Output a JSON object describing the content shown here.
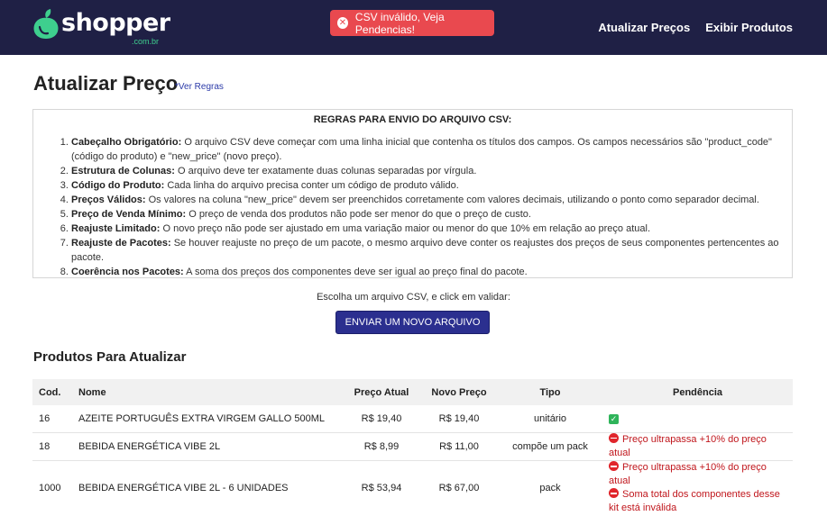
{
  "header": {
    "brand": "shopper",
    "brand_sub": ".com.br",
    "nav": [
      "Atualizar Preços",
      "Exibir Produtos"
    ],
    "colors": {
      "bar": "#1f2045",
      "accent": "#3ecf8e"
    }
  },
  "toast": {
    "text": "CSV inválido, Veja Pendencias!",
    "icon": "error-circle-icon",
    "color": "#e9494f"
  },
  "page": {
    "title": "Atualizar Preço",
    "rules_link": "*Ver Regras"
  },
  "rules": {
    "heading": "REGRAS PARA ENVIO DO ARQUIVO CSV:",
    "items": [
      {
        "title": "Cabeçalho Obrigatório:",
        "text": "O arquivo CSV deve começar com uma linha inicial que contenha os títulos dos campos. Os campos necessários são \"product_code\" (código do produto) e \"new_price\" (novo preço)."
      },
      {
        "title": "Estrutura de Colunas:",
        "text": "O arquivo deve ter exatamente duas colunas separadas por vírgula."
      },
      {
        "title": "Código do Produto:",
        "text": "Cada linha do arquivo precisa conter um código de produto válido."
      },
      {
        "title": "Preços Válidos:",
        "text": "Os valores na coluna \"new_price\" devem ser preenchidos corretamente com valores decimais, utilizando o ponto como separador decimal."
      },
      {
        "title": "Preço de Venda Mínimo:",
        "text": "O preço de venda dos produtos não pode ser menor do que o preço de custo."
      },
      {
        "title": "Reajuste Limitado:",
        "text": "O novo preço não pode ser ajustado em uma variação maior ou menor do que 10% em relação ao preço atual."
      },
      {
        "title": "Reajuste de Pacotes:",
        "text": "Se houver reajuste no preço de um pacote, o mesmo arquivo deve conter os reajustes dos preços de seus componentes pertencentes ao pacote."
      },
      {
        "title": "Coerência nos Pacotes:",
        "text": "A soma dos preços dos componentes deve ser igual ao preço final do pacote."
      }
    ]
  },
  "upload": {
    "prompt": "Escolha um arquivo CSV, e click em validar:",
    "button": "ENVIAR UM NOVO ARQUIVO"
  },
  "products": {
    "title": "Produtos Para Atualizar",
    "columns": [
      "Cod.",
      "Nome",
      "Preço Atual",
      "Novo Preço",
      "Tipo",
      "Pendência"
    ],
    "rows": [
      {
        "code": "16",
        "name": "AZEITE PORTUGUÊS EXTRA VIRGEM GALLO 500ML",
        "current": "R$ 19,40",
        "new": "R$ 19,40",
        "type": "unitário",
        "pending": [],
        "status": "ok"
      },
      {
        "code": "18",
        "name": "BEBIDA ENERGÉTICA VIBE 2L",
        "current": "R$ 8,99",
        "new": "R$ 11,00",
        "type": "compõe um pack",
        "pending": [
          "Preço ultrapassa +10% do preço atual"
        ],
        "status": "error"
      },
      {
        "code": "1000",
        "name": "BEBIDA ENERGÉTICA VIBE 2L - 6 UNIDADES",
        "current": "R$ 53,94",
        "new": "R$ 67,00",
        "type": "pack",
        "pending": [
          "Preço ultrapassa +10% do preço atual",
          "Soma total dos componentes desse kit está inválida"
        ],
        "status": "error"
      }
    ]
  }
}
